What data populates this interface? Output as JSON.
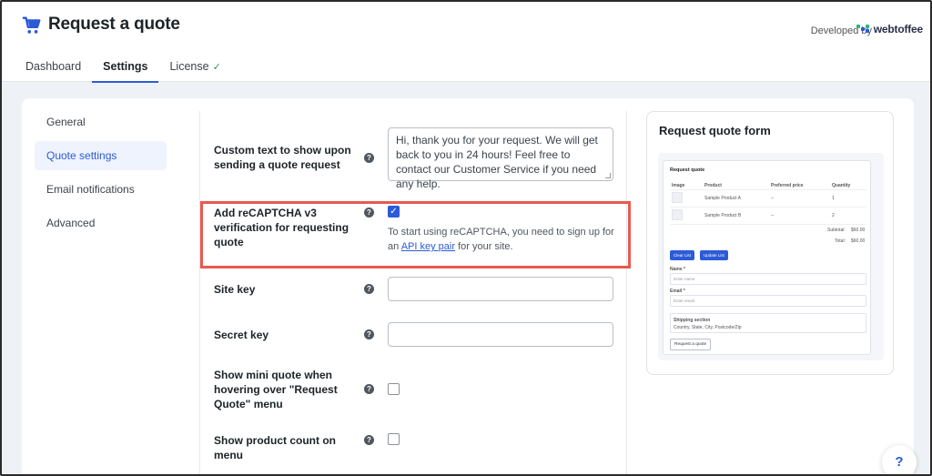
{
  "header": {
    "title": "Request a quote",
    "developed_by": "Developed by",
    "brand": "webtoffee"
  },
  "tabs": [
    {
      "label": "Dashboard",
      "active": false
    },
    {
      "label": "Settings",
      "active": true
    },
    {
      "label": "License",
      "active": false,
      "badge": "✓"
    }
  ],
  "sidebar": {
    "items": [
      {
        "label": "General",
        "active": false
      },
      {
        "label": "Quote settings",
        "active": true
      },
      {
        "label": "Email notifications",
        "active": false
      },
      {
        "label": "Advanced",
        "active": false
      }
    ]
  },
  "form": {
    "custom_text": {
      "label": "Custom text to show upon sending a quote request",
      "value": "Hi, thank you for your request. We will get back to you in 24 hours! Feel free to contact our Customer Service if you need any help."
    },
    "recaptcha": {
      "label": "Add reCAPTCHA v3 verification for requesting quote",
      "checked": true,
      "desc_prefix": "To start using reCAPTCHA, you need to sign up for an",
      "link": "API key pair",
      "desc_suffix": "for your site."
    },
    "site_key": {
      "label": "Site key",
      "value": ""
    },
    "secret_key": {
      "label": "Secret key",
      "value": ""
    },
    "mini_quote": {
      "label": "Show mini quote when hovering over \"Request Quote\" menu",
      "checked": false
    },
    "product_count": {
      "label": "Show product count on menu",
      "checked": false
    },
    "help_icon": "?"
  },
  "preview": {
    "title": "Request quote form",
    "form_heading": "Request quote",
    "columns": [
      "Image",
      "Product",
      "Preferred price",
      "Quantity"
    ],
    "rows": [
      {
        "product": "Sample Product A",
        "price": "--",
        "qty": "1"
      },
      {
        "product": "Sample Product B",
        "price": "--",
        "qty": "2"
      }
    ],
    "subtotal_label": "Subtotal:",
    "subtotal": "$60.00",
    "total_label": "Total:",
    "total": "$60.00",
    "clear_btn": "Clear List",
    "update_btn": "Update List",
    "name_label": "Name *",
    "name_placeholder": "Enter name",
    "email_label": "Email *",
    "email_placeholder": "Enter email",
    "shipping_label": "Shipping section",
    "shipping_placeholder": "Country, State, City, Postcode/Zip",
    "submit_btn": "Request a quote"
  },
  "help_fab": "?",
  "colors": {
    "accent": "#2b5bd7",
    "highlight": "#e85a4f",
    "success": "#2e9e4f"
  }
}
